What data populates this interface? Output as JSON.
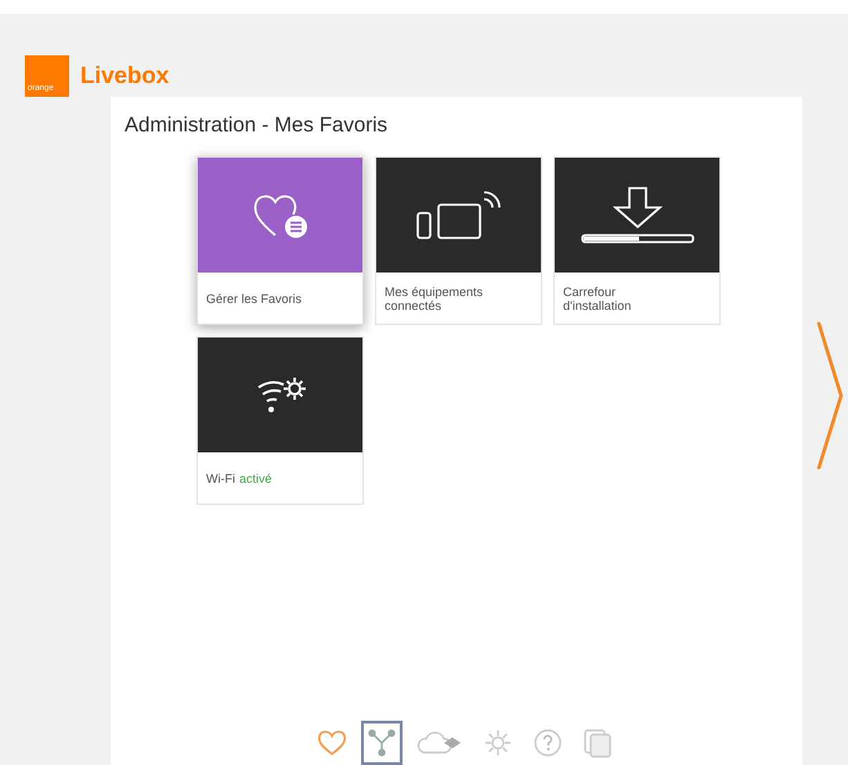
{
  "header": {
    "logo_text": "orange",
    "brand": "Livebox"
  },
  "panel": {
    "title": "Administration - Mes Favoris"
  },
  "tiles": [
    {
      "kind": "favorites",
      "label": "Gérer les Favoris",
      "selected": true
    },
    {
      "kind": "devices",
      "label": "Mes équipements connectés",
      "selected": false
    },
    {
      "kind": "install",
      "label": "Carrefour d'installation",
      "selected": false
    },
    {
      "kind": "wifi",
      "label": "Wi-Fi",
      "status": "activé",
      "selected": false
    }
  ],
  "nav": [
    {
      "kind": "heart",
      "selected": false
    },
    {
      "kind": "network",
      "selected": true
    },
    {
      "kind": "cloud",
      "selected": false
    },
    {
      "kind": "gear",
      "selected": false
    },
    {
      "kind": "help",
      "selected": false
    },
    {
      "kind": "pages",
      "selected": false
    }
  ]
}
